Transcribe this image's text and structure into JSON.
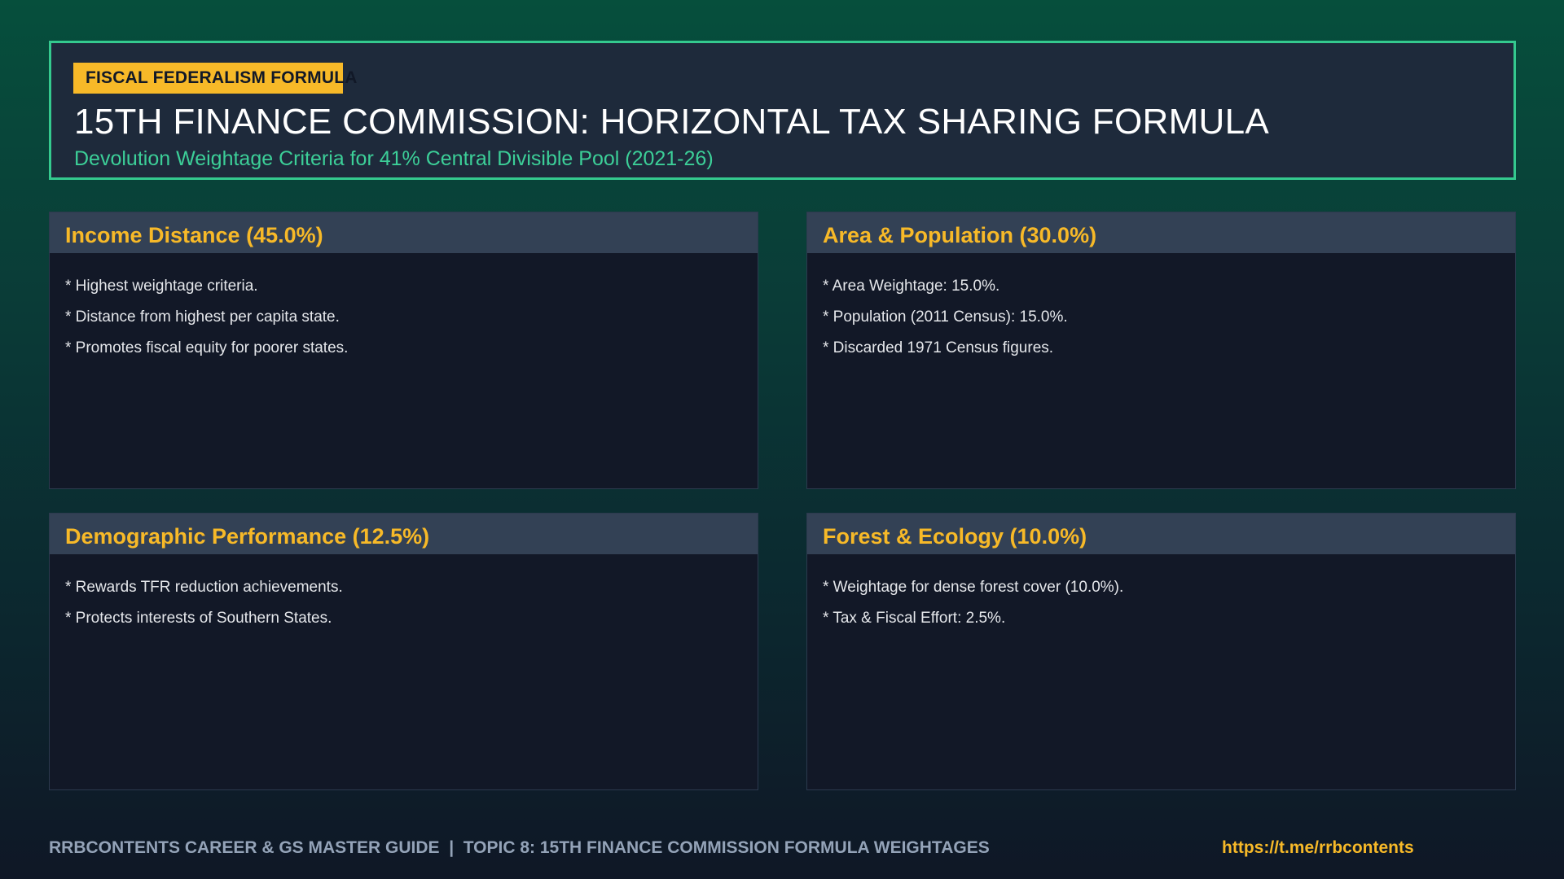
{
  "header": {
    "tag": "FISCAL FEDERALISM FORMULA",
    "title": "15TH FINANCE COMMISSION: HORIZONTAL TAX SHARING FORMULA",
    "subtitle": "Devolution Weightage Criteria for 41% Central Divisible Pool (2021-26)"
  },
  "cards": [
    {
      "title": "Income Distance (45.0%)",
      "bullets": [
        "* Highest weightage criteria.",
        "* Distance from highest per capita state.",
        "* Promotes fiscal equity for poorer states."
      ]
    },
    {
      "title": "Area & Population (30.0%)",
      "bullets": [
        "* Area Weightage: 15.0%.",
        "* Population (2011 Census): 15.0%.",
        "* Discarded 1971 Census figures."
      ]
    },
    {
      "title": "Demographic Performance (12.5%)",
      "bullets": [
        "* Rewards TFR reduction achievements.",
        "* Protects interests of Southern States."
      ]
    },
    {
      "title": "Forest & Ecology (10.0%)",
      "bullets": [
        "* Weightage for dense forest cover (10.0%).",
        "* Tax & Fiscal Effort: 2.5%."
      ]
    }
  ],
  "footer": {
    "text": "RRBCONTENTS CAREER & GS MASTER GUIDE  |  TOPIC 8: 15TH FINANCE COMMISSION FORMULA WEIGHTAGES",
    "link": "https://t.me/rrbcontents"
  },
  "colors": {
    "accent": "#f7b928",
    "border": "#34c98e",
    "subtitle": "#3ccf98",
    "card_bg": "#121827",
    "card_head_bg": "#334155"
  }
}
